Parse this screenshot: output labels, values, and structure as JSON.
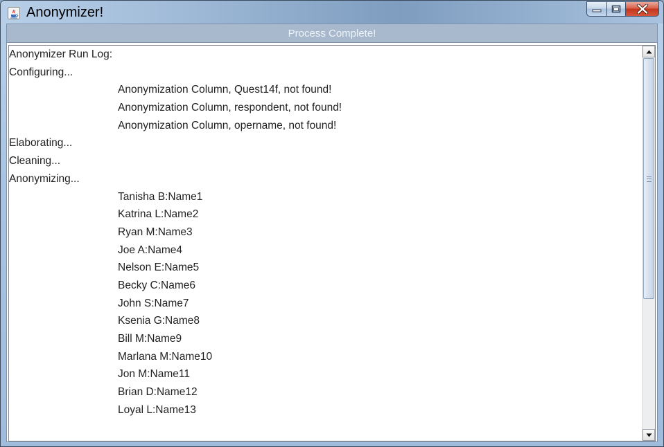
{
  "window": {
    "title": "Anonymizer!",
    "icon": "java-cup-icon"
  },
  "status": {
    "text": "Process Complete!"
  },
  "log": {
    "lines": [
      {
        "text": "Anonymizer Run Log:",
        "indent": false
      },
      {
        "text": "Configuring...",
        "indent": false
      },
      {
        "text": "Anonymization Column, Quest14f, not found!",
        "indent": true
      },
      {
        "text": "Anonymization Column, respondent, not found!",
        "indent": true
      },
      {
        "text": "Anonymization Column, opername, not found!",
        "indent": true
      },
      {
        "text": "Elaborating...",
        "indent": false
      },
      {
        "text": "Cleaning...",
        "indent": false
      },
      {
        "text": "Anonymizing...",
        "indent": false
      },
      {
        "text": "Tanisha B:Name1",
        "indent": true
      },
      {
        "text": "Katrina L:Name2",
        "indent": true
      },
      {
        "text": "Ryan M:Name3",
        "indent": true
      },
      {
        "text": "Joe A:Name4",
        "indent": true
      },
      {
        "text": "Nelson E:Name5",
        "indent": true
      },
      {
        "text": "Becky C:Name6",
        "indent": true
      },
      {
        "text": "John S:Name7",
        "indent": true
      },
      {
        "text": "Ksenia G:Name8",
        "indent": true
      },
      {
        "text": "Bill M:Name9",
        "indent": true
      },
      {
        "text": "Marlana M:Name10",
        "indent": true
      },
      {
        "text": "Jon M:Name11",
        "indent": true
      },
      {
        "text": "Brian D:Name12",
        "indent": true
      },
      {
        "text": "Loyal L:Name13",
        "indent": true
      }
    ]
  },
  "scrollbar": {
    "position_fraction": 0.0,
    "visible_fraction": 0.65
  }
}
